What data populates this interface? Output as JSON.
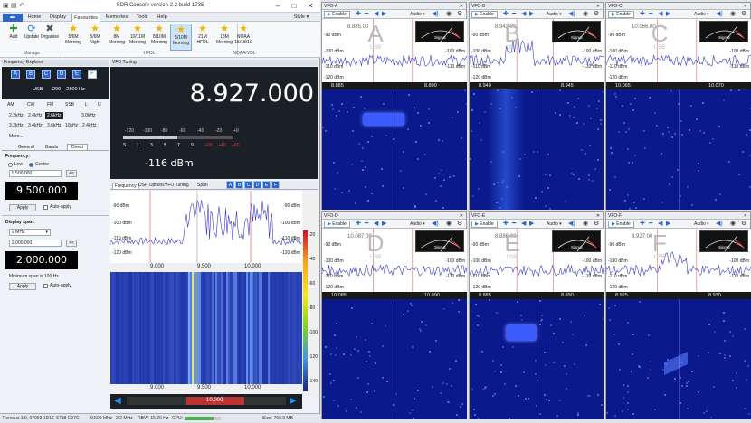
{
  "app": {
    "title": "SDR Console version 2.2 build 1735",
    "style_label": "Style"
  },
  "tabs": [
    "Home",
    "Display",
    "Favourites",
    "Memories",
    "Tools",
    "Help"
  ],
  "ribbon": {
    "manage": [
      {
        "label": "Add",
        "icon": "plus-icon"
      },
      {
        "label": "Update",
        "icon": "refresh-icon"
      },
      {
        "label": "Organise",
        "icon": "tools-icon"
      }
    ],
    "favs": [
      {
        "label": "5/6M\nMorning"
      },
      {
        "label": "5/6M\nNight"
      },
      {
        "label": "8M\nMorning"
      },
      {
        "label": "10/11M\nMorning"
      },
      {
        "label": "8/10M\nMorning"
      },
      {
        "label": "5/10M\nMorning"
      },
      {
        "label": "21M\nHFDL"
      },
      {
        "label": "13M\nMorning"
      },
      {
        "label": "NOAA\n15/18/19"
      }
    ],
    "groups": [
      "Manage",
      "HFDL",
      "NOAA/VDL"
    ]
  },
  "freq_explorer": {
    "title": "Frequency Explorer",
    "vfo_buttons": [
      "A",
      "B",
      "C",
      "D",
      "E",
      "F"
    ],
    "mode": "USB",
    "bw_range": "200 – 2800 Hz",
    "mode_buttons": [
      "AM",
      "CW",
      "FM",
      "SSB",
      "L",
      "U"
    ],
    "bw_row1": [
      "2.2kHz",
      "2.4kHz",
      "2.6kHz",
      "3.0kHz"
    ],
    "bw_row2": [
      "3.2kHz",
      "3.4kHz",
      "3.6kHz",
      "10kHz",
      "2.4kHz"
    ],
    "more": "More...",
    "subtabs": [
      "General",
      "Bands",
      "Direct"
    ],
    "frequency_label": "Frequency:",
    "low": "Low",
    "centre": "Centre",
    "freq_input": "9.500.000",
    "freq_display": "9.500.000",
    "apply": "Apply",
    "auto_apply": "Auto-apply",
    "span_label": "Display span:",
    "span_select": "2 MHz",
    "span_input": "2.000.000",
    "span_display": "2.000.000",
    "min_span": "Minimum span is 100 Hz"
  },
  "vfo_tuning": {
    "title": "VFO Tuning",
    "frequency": "8.927.000",
    "dbm": "-116 dBm",
    "scale_top": [
      "-120",
      "-100",
      "-80",
      "-60",
      "-40",
      "-20",
      "+0"
    ],
    "scale_bottom": [
      "S",
      "1",
      "3",
      "5",
      "7",
      "9",
      "+20",
      "+40",
      "+60"
    ]
  },
  "main_spectrum": {
    "tabs": [
      "Frequency",
      "DSP Options",
      "VFO Tuning",
      "Span"
    ],
    "vfo_btns": [
      "A",
      "B",
      "C",
      "D",
      "E",
      "F"
    ],
    "db_left": [
      "-90 dBm",
      "-100 dBm",
      "-110 dBm",
      "-120 dBm"
    ],
    "db_right": [
      "-90 dBm",
      "-100 dBm",
      "-110 dBm",
      "-120 dBm"
    ],
    "freq_ticks": [
      "9.000",
      "9.500",
      "10.000"
    ],
    "side_scale": [
      "-20",
      "-40",
      "-60",
      "-80",
      "-100",
      "-120",
      "-140"
    ],
    "wf_ticks": [
      "9.000",
      "9.500",
      "10.000"
    ],
    "tune_freq": "10.000"
  },
  "vfos": [
    {
      "name": "VFO-A",
      "letter": "A",
      "mode": "USB",
      "freq": "8.885.00",
      "ticks": [
        "8.885",
        "8.890"
      ],
      "enable": "Enable",
      "audio": "Audio",
      "db": [
        "-90 dBm",
        "-100 dBm",
        "-110 dBm",
        "-120 dBm"
      ]
    },
    {
      "name": "VFO-B",
      "letter": "B",
      "mode": "USB",
      "freq": "8.942.00",
      "ticks": [
        "8.940",
        "8.945"
      ],
      "enable": "Enable",
      "audio": "Audio",
      "db": [
        "-90 dBm",
        "-100 dBm",
        "-110 dBm",
        "-120 dBm"
      ]
    },
    {
      "name": "VFO-C",
      "letter": "C",
      "mode": "USB",
      "freq": "10.066.00",
      "ticks": [
        "10.065",
        "10.070"
      ],
      "enable": "Enable",
      "audio": "Audio",
      "db": [
        "-90 dBm",
        "-100 dBm",
        "-110 dBm",
        "-120 dBm"
      ]
    },
    {
      "name": "VFO-D",
      "letter": "D",
      "mode": "USB",
      "freq": "10.087.00",
      "ticks": [
        "10.085",
        "10.090"
      ],
      "enable": "Enable",
      "audio": "Audio",
      "db": [
        "-90 dBm",
        "-100 dBm",
        "-110 dBm",
        "-120 dBm"
      ]
    },
    {
      "name": "VFO-E",
      "letter": "E",
      "mode": "USB",
      "freq": "8.886.00",
      "ticks": [
        "8.885",
        "8.890"
      ],
      "enable": "Enable",
      "audio": "Audio",
      "db": [
        "-90 dBm",
        "-100 dBm",
        "-110 dBm",
        "-120 dBm"
      ]
    },
    {
      "name": "VFO-F",
      "letter": "F",
      "mode": "USB",
      "freq": "8.927.00",
      "ticks": [
        "8.925",
        "8.930"
      ],
      "enable": "Enable",
      "audio": "Audio",
      "db": [
        "-90 dBm",
        "-100 dBm",
        "-110 dBm",
        "-120 dBm"
      ]
    }
  ],
  "meter": {
    "label": "Signal",
    "scale": [
      "-120",
      "-100",
      "-80",
      "-60",
      "-40",
      "-20"
    ]
  },
  "status": {
    "device": "Perseus 1.0, 07093-1D1E-5718-E07C",
    "freq": "9.500 MHz",
    "bw": "2.2 MHz",
    "rbw": "RBW: 15.26 Hz",
    "cpu": "CPU:",
    "size": "Size: 768.9 MB"
  },
  "colors": {
    "accent": "#2d66c7",
    "wf_dark": "#0a1a8c",
    "signal": "#3a3acc"
  }
}
